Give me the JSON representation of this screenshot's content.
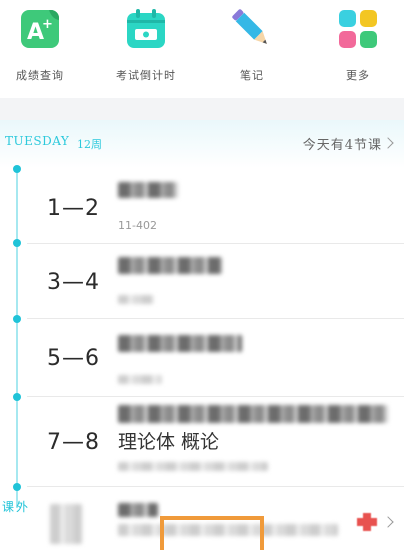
{
  "shortcuts": [
    {
      "label": "成绩查询",
      "icon": "grade-a-plus-icon"
    },
    {
      "label": "考试倒计时",
      "icon": "calendar-countdown-icon"
    },
    {
      "label": "笔记",
      "icon": "pencil-icon"
    },
    {
      "label": "更多",
      "icon": "more-grid-icon"
    }
  ],
  "day": {
    "name": "TUESDAY",
    "week": "12周",
    "today_summary": "今天有4节课"
  },
  "courses": [
    {
      "period": "1—2",
      "room": "11-402"
    },
    {
      "period": "3—4",
      "room": ""
    },
    {
      "period": "5—6",
      "room": ""
    },
    {
      "period": "7—8",
      "title_visible": "理论体    概论",
      "room": ""
    }
  ],
  "extra": {
    "label": "课外"
  },
  "colors": {
    "accent": "#1fc3d8",
    "grade_icon": "#3ec97a",
    "calendar_icon": "#2bd6c4",
    "pencil_icon": "#35b8e6",
    "highlight_frame": "#f09a3a",
    "badge_red": "#e8524f"
  }
}
